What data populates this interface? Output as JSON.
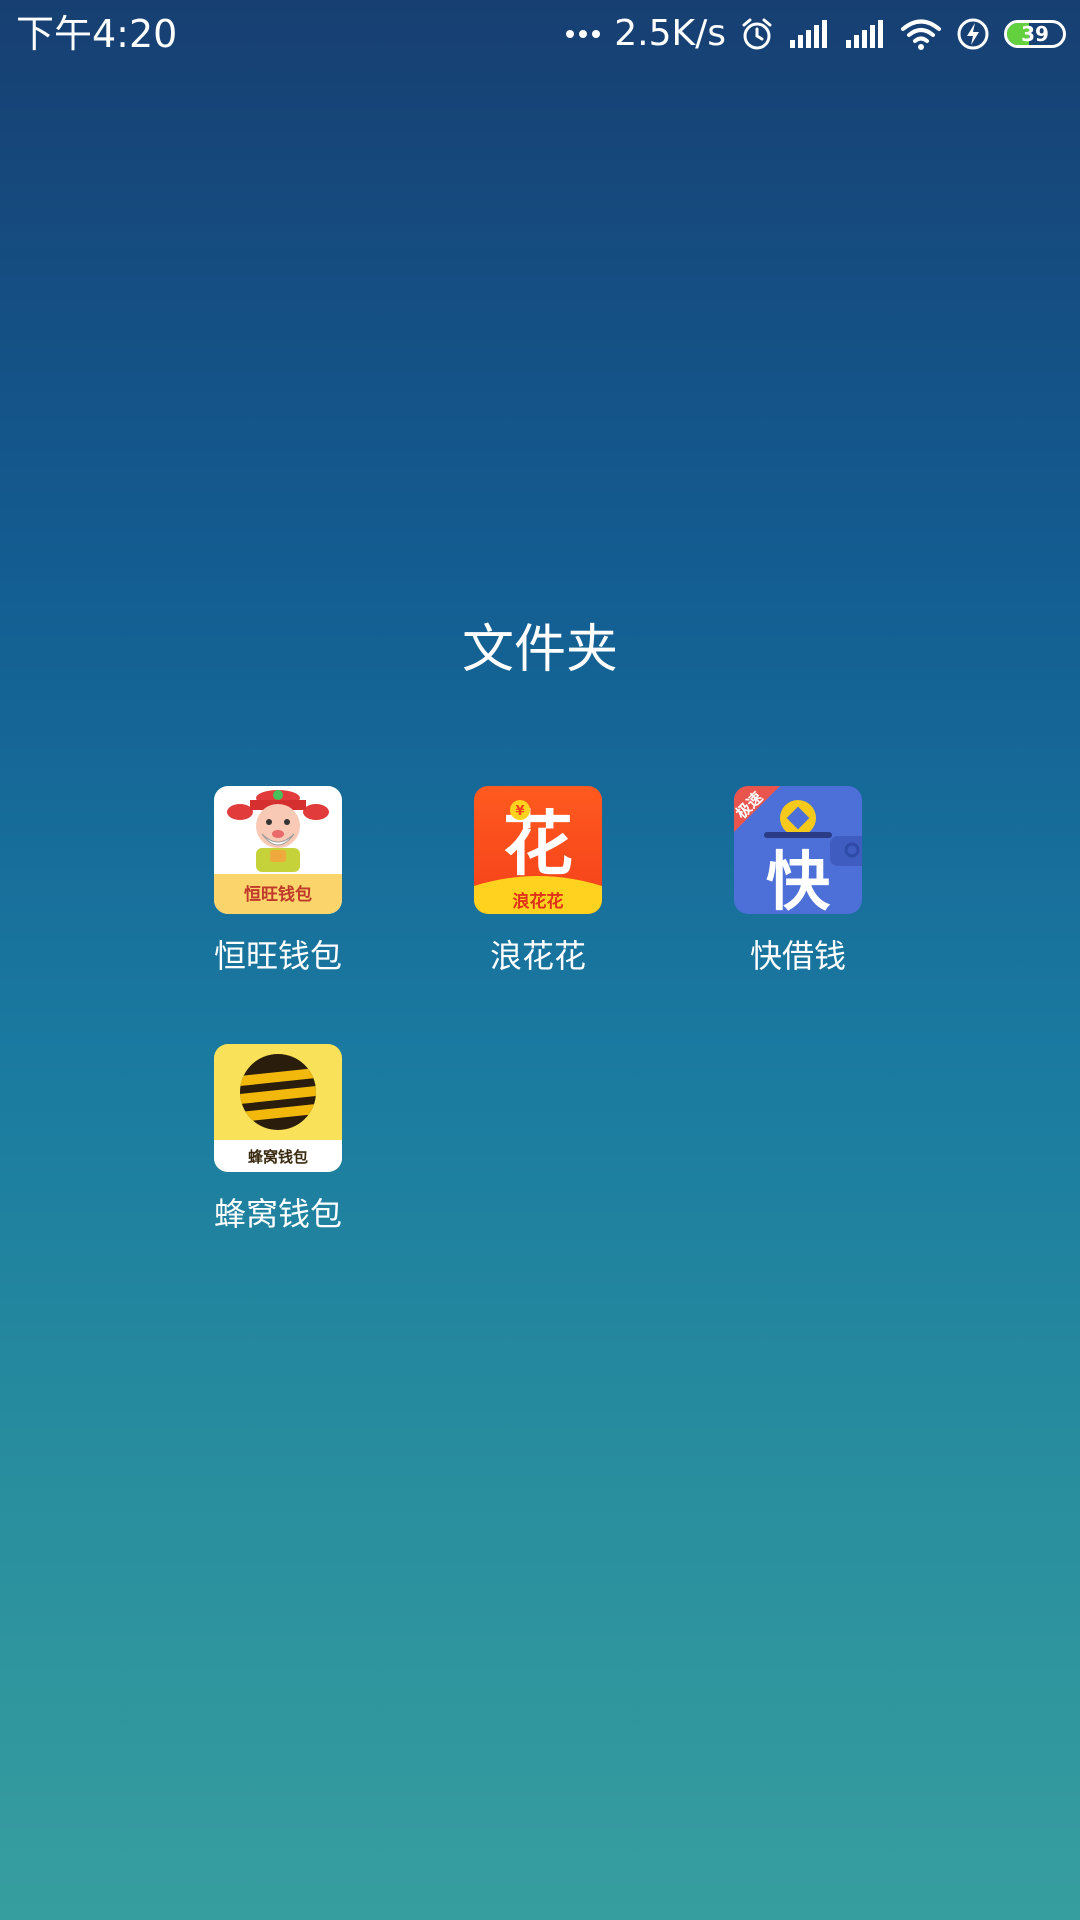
{
  "status_bar": {
    "time": "下午4:20",
    "net_speed": "2.5K/s",
    "battery_level": "39",
    "battery_fraction": 0.39
  },
  "folder": {
    "title": "文件夹",
    "apps": [
      {
        "name": "恒旺钱包",
        "icon": "hengwang-wallet-icon",
        "icon_text": "恒旺钱包"
      },
      {
        "name": "浪花花",
        "icon": "langhuahua-icon",
        "icon_text": "浪花花",
        "icon_glyph": "花",
        "icon_badge": "¥"
      },
      {
        "name": "快借钱",
        "icon": "kuaijieqian-icon",
        "icon_glyph": "快",
        "icon_ribbon": "极速"
      },
      {
        "name": "蜂窝钱包",
        "icon": "fengwo-wallet-icon",
        "icon_text": "蜂窝钱包"
      }
    ]
  },
  "colors": {
    "background_top": "#173f72",
    "background_bottom": "#379e9f",
    "battery_fill": "#63d13e"
  }
}
